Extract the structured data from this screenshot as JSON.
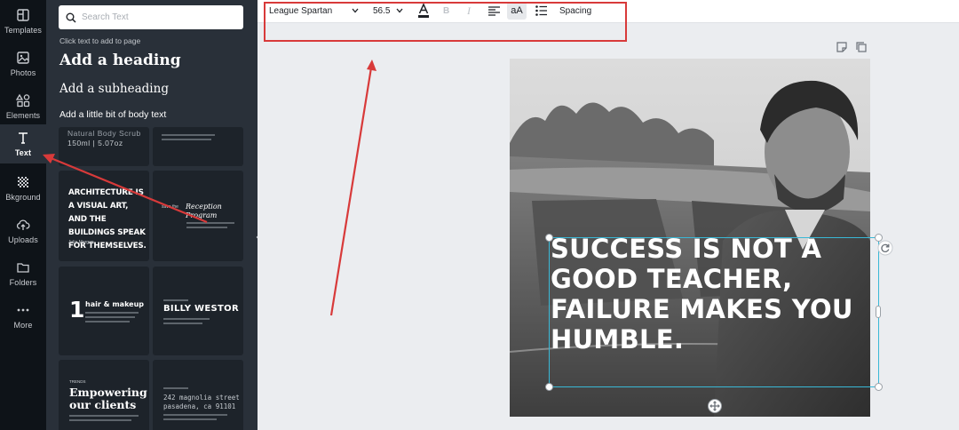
{
  "rail": {
    "items": [
      {
        "label": "Templates",
        "icon": "layout-icon"
      },
      {
        "label": "Photos",
        "icon": "image-icon"
      },
      {
        "label": "Elements",
        "icon": "shapes-icon"
      },
      {
        "label": "Text",
        "icon": "text-icon"
      },
      {
        "label": "Bkground",
        "icon": "pattern-icon"
      },
      {
        "label": "Uploads",
        "icon": "cloud-upload-icon"
      },
      {
        "label": "Folders",
        "icon": "folder-icon"
      },
      {
        "label": "More",
        "icon": "ellipsis-icon"
      }
    ],
    "active": "Text"
  },
  "panel": {
    "search_placeholder": "Search Text",
    "hint": "Click text to add to page",
    "add_heading": "Add a heading",
    "add_subheading": "Add a subheading",
    "add_body": "Add a little bit of body text",
    "templates": {
      "t1": {
        "line1": "Natural Body Scrub",
        "line2": "150ml | 5.07oz"
      },
      "t3": {
        "text": "ARCHITECTURE IS A VISUAL ART, AND THE BUILDINGS SPEAK FOR THEMSELVES.",
        "small": "Julia Morgan"
      },
      "t4": {
        "label": "save the",
        "title": "Reception Program"
      },
      "t5": {
        "num": "1",
        "title": "hair & makeup"
      },
      "t6": {
        "title": "BILLY WESTOR"
      },
      "t7": {
        "small": "TRENDS",
        "title": "Empowering our clients"
      },
      "t8": {
        "line1": "242 magnolia street",
        "line2": "pasadena, ca 91101"
      }
    }
  },
  "toolbar": {
    "font": "League Spartan",
    "size": "56.5",
    "bold": "B",
    "italic": "I",
    "case": "aA",
    "spacing": "Spacing",
    "text_color": "#1e2126"
  },
  "canvas": {
    "quote": "SUCCESS IS NOT A GOOD TEACHER, FAILURE MAKES YOU HUMBLE."
  },
  "colors": {
    "rail_bg": "#0e1318",
    "panel_bg": "#293039",
    "selection": "#39b8d6",
    "annotation": "#d83a3a"
  }
}
